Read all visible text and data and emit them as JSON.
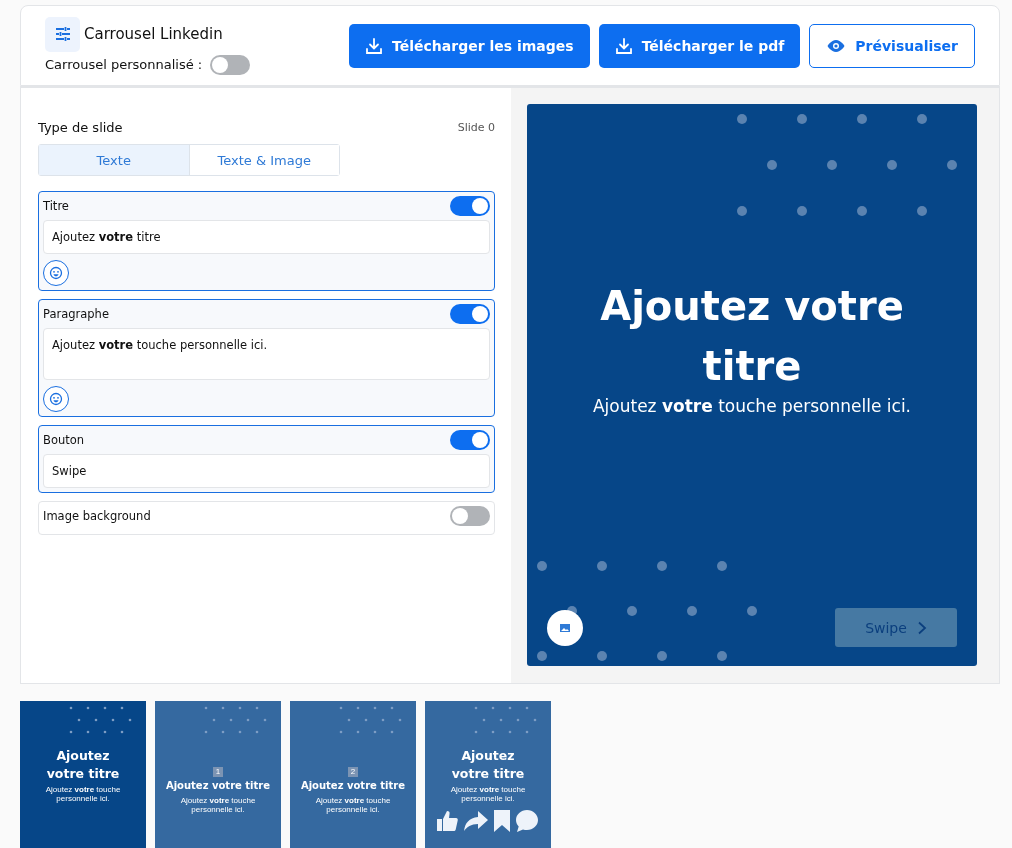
{
  "header": {
    "title": "Carrousel Linkedin",
    "custom_label": "Carrousel personnalisé :",
    "custom_on": false,
    "buttons": [
      {
        "label": "Télécharger les images",
        "kind": "download"
      },
      {
        "label": "Télécharger le pdf",
        "kind": "download"
      },
      {
        "label": "Prévisualiser",
        "kind": "preview"
      }
    ]
  },
  "editor": {
    "heading": "Type de slide",
    "slide_label": "Slide 0",
    "tabs": [
      {
        "label": "Texte",
        "selected": true
      },
      {
        "label": "Texte & Image",
        "selected": false
      }
    ],
    "fields": [
      {
        "label": "Titre",
        "on": true,
        "kind": "text",
        "value": "Ajoutez **votre** titre",
        "emoji": true
      },
      {
        "label": "Paragraphe",
        "on": true,
        "kind": "textarea",
        "value": "Ajoutez **votre** touche personnelle ici.",
        "emoji": true
      },
      {
        "label": "Bouton",
        "on": true,
        "kind": "text",
        "value": "Swipe",
        "emoji": false
      },
      {
        "label": "Image background",
        "on": false,
        "kind": "toggle"
      }
    ]
  },
  "preview": {
    "title": "Ajoutez **votre** titre",
    "paragraph": "Ajoutez **votre** touche personnelle ici.",
    "button": "Swipe"
  },
  "thumbnails": [
    {
      "kind": "title",
      "selected": true,
      "title": "Ajoutez **votre** titre",
      "paragraph": "Ajoutez **votre** touche personnelle ici."
    },
    {
      "kind": "numbered",
      "selected": false,
      "number": "1",
      "title": "Ajoutez **votre** titre",
      "paragraph": "Ajoutez **votre** touche personnelle ici."
    },
    {
      "kind": "numbered",
      "selected": false,
      "number": "2",
      "title": "Ajoutez **votre** titre",
      "paragraph": "Ajoutez **votre** touche personnelle ici."
    },
    {
      "kind": "end",
      "selected": false,
      "title": "Ajoutez **votre** titre",
      "paragraph": "Ajoutez **votre** touche personnelle ici."
    }
  ]
}
